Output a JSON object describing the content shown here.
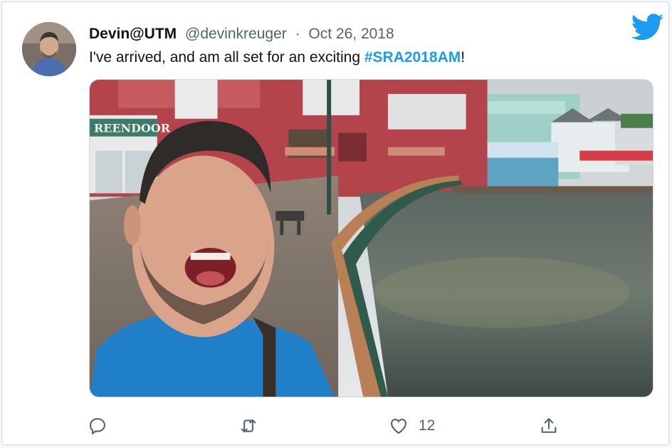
{
  "tweet": {
    "author_name": "Devin@UTM",
    "handle": "@devinkreuger",
    "separator": "·",
    "date": "Oct 26, 2018",
    "text_before": "I've arrived, and am all set for an exciting ",
    "hashtag": "#SRA2018AM",
    "text_after": "!"
  },
  "media": {
    "sign_text": "REENDOOR"
  },
  "actions": {
    "reply_count": "",
    "retweet_count": "",
    "like_count": "12"
  },
  "icons": {
    "logo": "twitter-bird-icon",
    "reply": "reply-icon",
    "retweet": "retweet-icon",
    "like": "heart-icon",
    "share": "share-icon"
  },
  "colors": {
    "accent": "#1d9bf0",
    "text": "#0f1419",
    "muted": "#536471",
    "border": "#cfd9de"
  }
}
